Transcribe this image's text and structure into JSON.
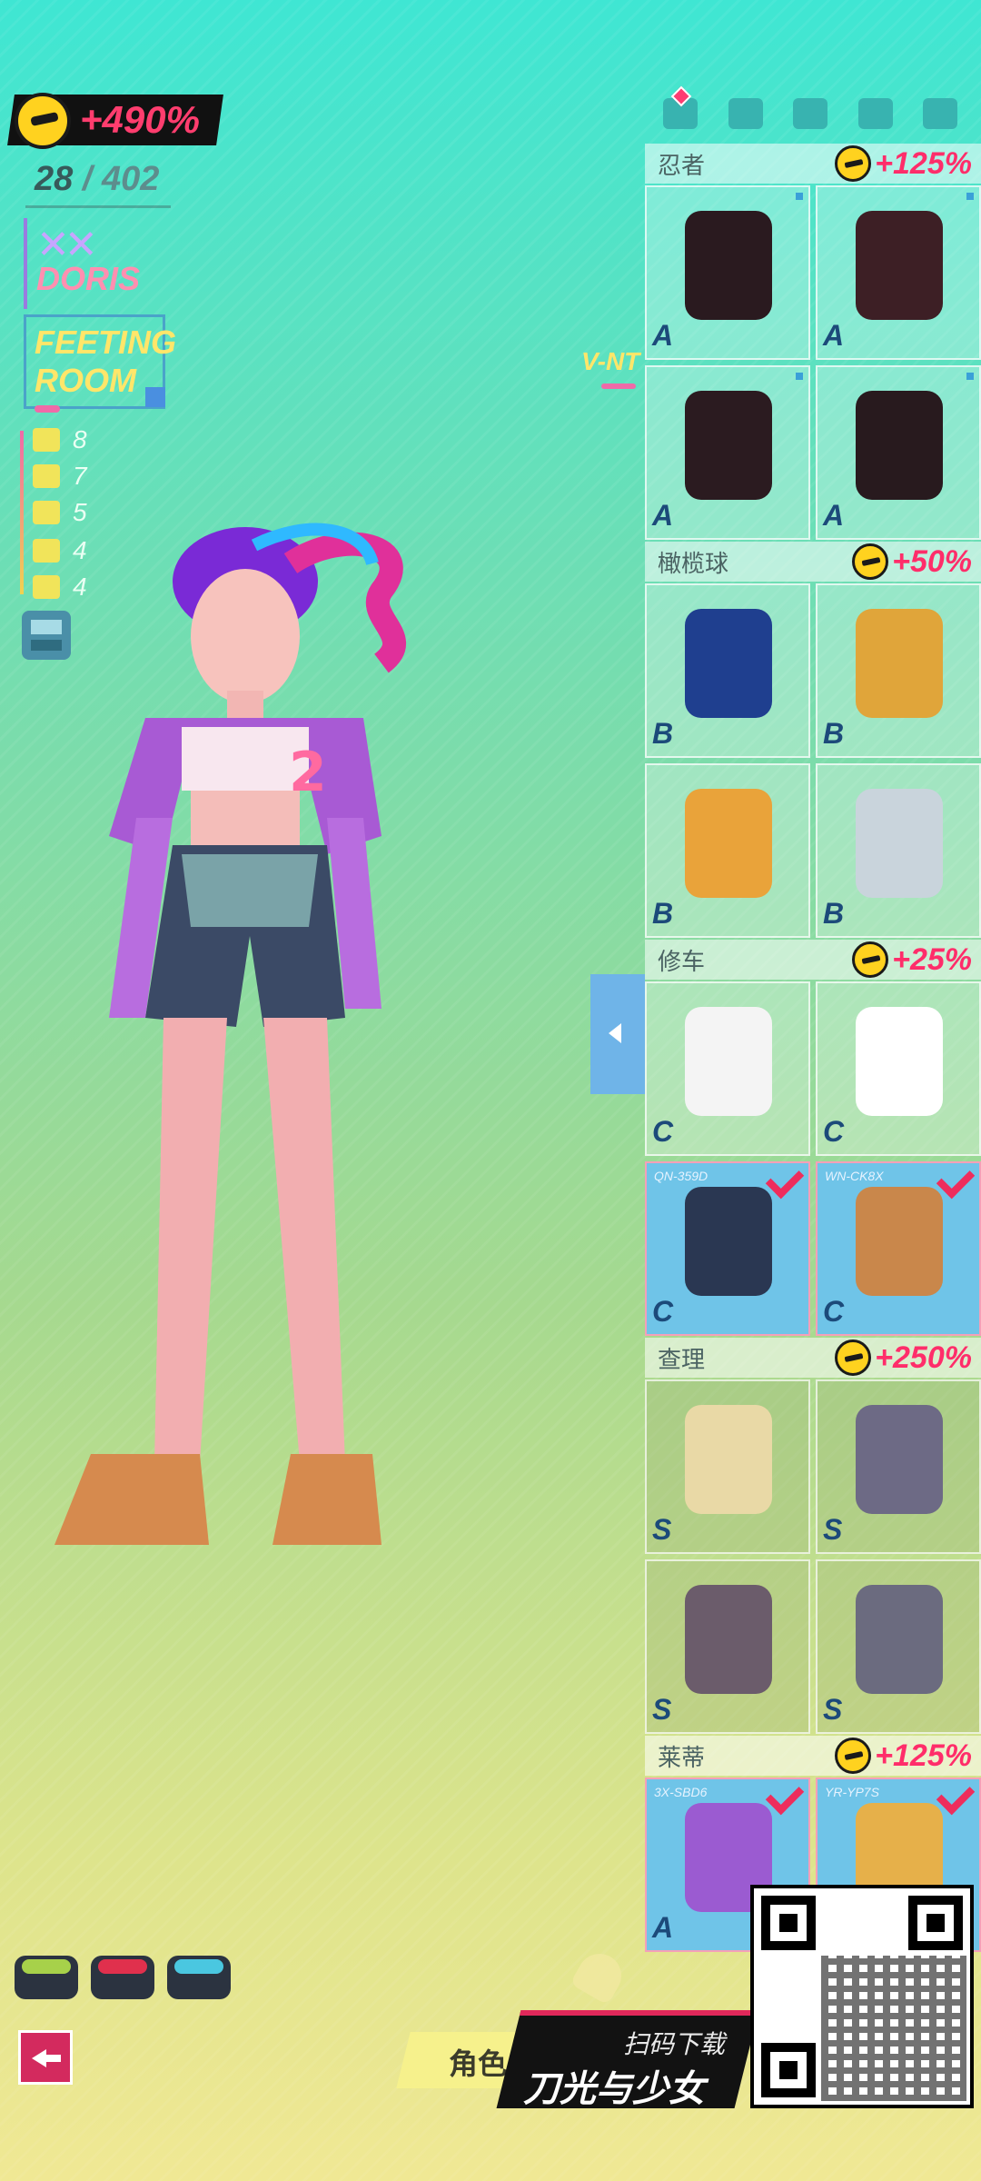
{
  "boost": {
    "value": "+490%"
  },
  "collection": {
    "owned": "28",
    "separator": "/",
    "total": "402"
  },
  "character": {
    "name": "DORIS",
    "marks": "✕✕"
  },
  "room": {
    "line1": "FEETING",
    "line2": "ROOM"
  },
  "stats": [
    {
      "icon": "hat-icon",
      "value": "8"
    },
    {
      "icon": "shirt-icon",
      "value": "7"
    },
    {
      "icon": "glove-icon",
      "value": "5"
    },
    {
      "icon": "pants-icon",
      "value": "4"
    },
    {
      "icon": "shoe-icon",
      "value": "4"
    }
  ],
  "brand_tag": "V-NT",
  "tabs": [
    "all-outfits-tab",
    "shirt-tab",
    "glove-tab",
    "pants-tab",
    "shoe-tab"
  ],
  "sets": [
    {
      "name": "忍者",
      "bonus": "+125%",
      "items": [
        {
          "rank": "A",
          "code": "",
          "equipped": false,
          "color": "#2a1a1f"
        },
        {
          "rank": "A",
          "code": "",
          "equipped": false,
          "color": "#3d1f25"
        },
        {
          "rank": "A",
          "code": "",
          "equipped": false,
          "color": "#2b1b20"
        },
        {
          "rank": "A",
          "code": "",
          "equipped": false,
          "color": "#281a1e"
        }
      ]
    },
    {
      "name": "橄榄球",
      "bonus": "+50%",
      "items": [
        {
          "rank": "B",
          "code": "",
          "equipped": false,
          "color": "#1f3f8f"
        },
        {
          "rank": "B",
          "code": "",
          "equipped": false,
          "color": "#e0a53a"
        },
        {
          "rank": "B",
          "code": "",
          "equipped": false,
          "color": "#e9a33a"
        },
        {
          "rank": "B",
          "code": "",
          "equipped": false,
          "color": "#c9d4dc"
        }
      ]
    },
    {
      "name": "修车",
      "bonus": "+25%",
      "items": [
        {
          "rank": "C",
          "code": "",
          "equipped": false,
          "color": "#f4f4f4"
        },
        {
          "rank": "C",
          "code": "",
          "equipped": false,
          "color": "#ffffff"
        },
        {
          "rank": "C",
          "code": "QN-359D",
          "equipped": true,
          "color": "#2a3752"
        },
        {
          "rank": "C",
          "code": "WN-CK8X",
          "equipped": true,
          "color": "#c9874b"
        }
      ]
    },
    {
      "name": "查理",
      "bonus": "+250%",
      "items": [
        {
          "rank": "S",
          "code": "",
          "equipped": false,
          "color": "#e9d9a6"
        },
        {
          "rank": "S",
          "code": "",
          "equipped": false,
          "color": "#6d6a85"
        },
        {
          "rank": "S",
          "code": "",
          "equipped": false,
          "color": "#6b5c6b"
        },
        {
          "rank": "S",
          "code": "",
          "equipped": false,
          "color": "#6b6b7f"
        }
      ]
    },
    {
      "name": "莱蒂",
      "bonus": "+125%",
      "items": [
        {
          "rank": "A",
          "code": "3X-SBD6",
          "equipped": true,
          "color": "#9b5bd1"
        },
        {
          "rank": "A",
          "code": "YR-YP7S",
          "equipped": true,
          "color": "#e6b04a"
        }
      ]
    }
  ],
  "presets": [
    "#a7d14a",
    "#e0304d",
    "#4ac7e0"
  ],
  "bottom": {
    "role_tab": "角色",
    "banner_sub": "扫码下载",
    "banner_main": "刀光与少女"
  },
  "colors": {
    "accent": "#ff2d6a",
    "equipped_bg": "#6fc4e8"
  }
}
